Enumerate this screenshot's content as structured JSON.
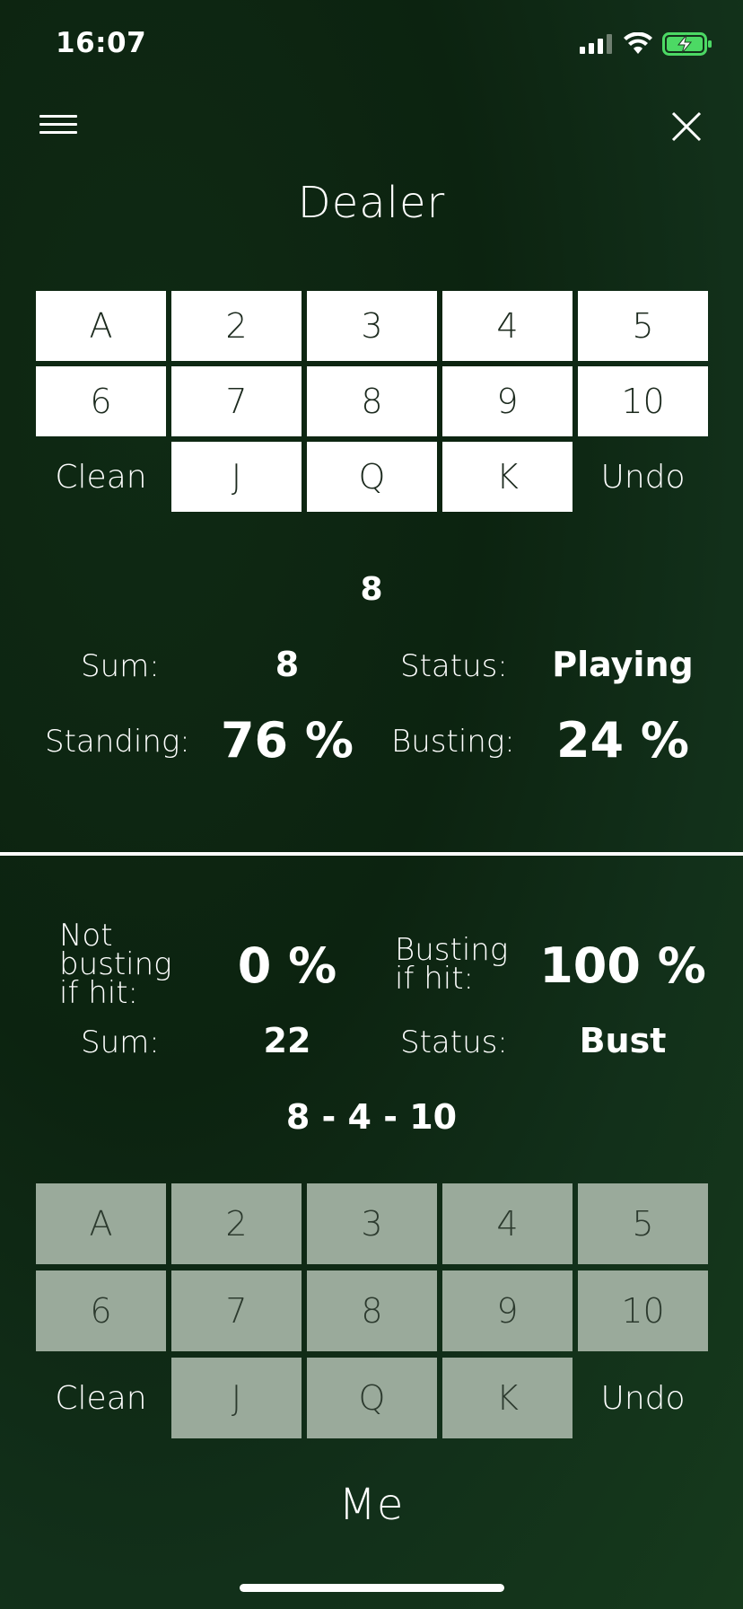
{
  "status_bar": {
    "time": "16:07"
  },
  "dealer": {
    "title": "Dealer",
    "cards": [
      [
        "A",
        "2",
        "3",
        "4",
        "5"
      ],
      [
        "6",
        "7",
        "8",
        "9",
        "10"
      ],
      [
        "Clean",
        "J",
        "Q",
        "K",
        "Undo"
      ]
    ],
    "hand": "8",
    "sum_label": "Sum:",
    "sum_value": "8",
    "status_label": "Status:",
    "status_value": "Playing",
    "standing_label": "Standing:",
    "standing_value": "76 %",
    "busting_label": "Busting:",
    "busting_value": "24 %"
  },
  "me": {
    "title": "Me",
    "not_busting_label": [
      "Not",
      "busting",
      "if hit:"
    ],
    "not_busting_value": "0 %",
    "busting_label": [
      "Busting",
      "if hit:"
    ],
    "busting_value": "100 %",
    "sum_label": "Sum:",
    "sum_value": "22",
    "status_label": "Status:",
    "status_value": "Bust",
    "hand": "8 - 4 - 10",
    "cards": [
      [
        "A",
        "2",
        "3",
        "4",
        "5"
      ],
      [
        "6",
        "7",
        "8",
        "9",
        "10"
      ],
      [
        "Clean",
        "J",
        "Q",
        "K",
        "Undo"
      ]
    ]
  },
  "colors": {
    "background": "#0f2a14",
    "dealer_card": "#ffffff",
    "me_card": "#9aaa9b"
  }
}
